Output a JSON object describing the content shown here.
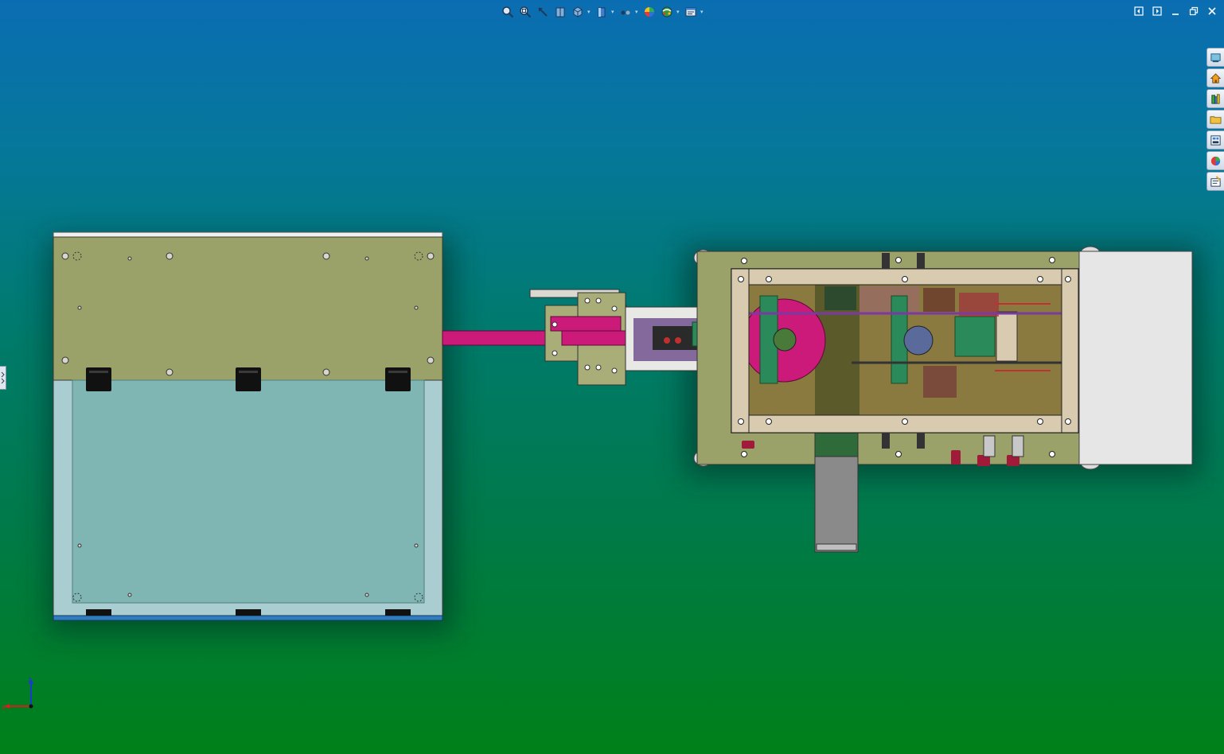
{
  "view_toolbar": {
    "buttons": [
      {
        "name": "zoom-to-fit-icon",
        "has_menu": false
      },
      {
        "name": "zoom-to-area-icon",
        "has_menu": false
      },
      {
        "name": "previous-view-icon",
        "has_menu": false
      },
      {
        "name": "section-view-icon",
        "has_menu": false
      },
      {
        "name": "view-orientation-icon",
        "has_menu": true
      },
      {
        "name": "display-style-icon",
        "has_menu": true
      },
      {
        "name": "hide-show-items-icon",
        "has_menu": true
      },
      {
        "name": "edit-appearance-icon",
        "has_menu": false
      },
      {
        "name": "apply-scene-icon",
        "has_menu": true
      },
      {
        "name": "view-settings-icon",
        "has_menu": true
      }
    ]
  },
  "window_controls": [
    "tile-left-icon",
    "tile-right-icon",
    "minimize-icon",
    "restore-icon",
    "close-icon"
  ],
  "task_pane": [
    "solidworks-resources-icon",
    "home-icon",
    "design-library-icon",
    "file-explorer-icon",
    "view-palette-icon",
    "appearances-scenes-icon",
    "custom-properties-icon"
  ],
  "triad": {
    "axes": [
      "Z",
      "X"
    ]
  },
  "colors": {
    "viewport_top": "#0a6db2",
    "viewport_bottom": "#008018",
    "olive_plate": "#9aa26a",
    "glass_panel": "#7fb5b2",
    "magenta_arm": "#cc1a7a",
    "frame_beige": "#d8cbb0",
    "white_cover": "#e6e6e6"
  }
}
